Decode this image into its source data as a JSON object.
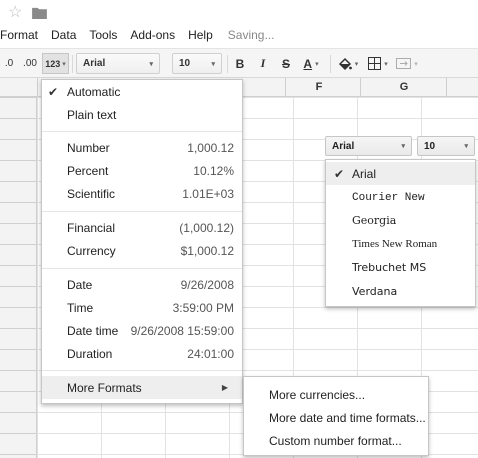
{
  "top": {
    "star_icon": "star-outline-icon",
    "folder_icon": "folder-icon"
  },
  "menubar": {
    "items": [
      "Format",
      "Data",
      "Tools",
      "Add-ons",
      "Help"
    ],
    "status": "Saving..."
  },
  "toolbar": {
    "decrease_decimals": ".0",
    "increase_decimals": ".00",
    "more_formats": "123",
    "font": "Arial",
    "font_size": "10",
    "bold": "B",
    "italic": "I",
    "strikethrough": "S",
    "text_color": "A",
    "text_color_bar": "#000000"
  },
  "columns": [
    "F",
    "G"
  ],
  "format_menu": {
    "automatic": "Automatic",
    "plain_text": "Plain text",
    "number": {
      "label": "Number",
      "example": "1,000.12"
    },
    "percent": {
      "label": "Percent",
      "example": "10.12%"
    },
    "scientific": {
      "label": "Scientific",
      "example": "1.01E+03"
    },
    "financial": {
      "label": "Financial",
      "example": "(1,000.12)"
    },
    "currency": {
      "label": "Currency",
      "example": "$1,000.12"
    },
    "date": {
      "label": "Date",
      "example": "9/26/2008"
    },
    "time": {
      "label": "Time",
      "example": "3:59:00 PM"
    },
    "date_time": {
      "label": "Date time",
      "example": "9/26/2008 15:59:00"
    },
    "duration": {
      "label": "Duration",
      "example": "24:01:00"
    },
    "more_formats": "More Formats"
  },
  "more_formats_submenu": {
    "currencies": "More currencies...",
    "date_time_formats": "More date and time formats...",
    "custom_number": "Custom number format..."
  },
  "font_popup": {
    "font_select": "Arial",
    "size_select": "10",
    "fonts": [
      "Arial",
      "Courier New",
      "Georgia",
      "Times New Roman",
      "Trebuchet MS",
      "Verdana"
    ],
    "selected": "Arial"
  }
}
